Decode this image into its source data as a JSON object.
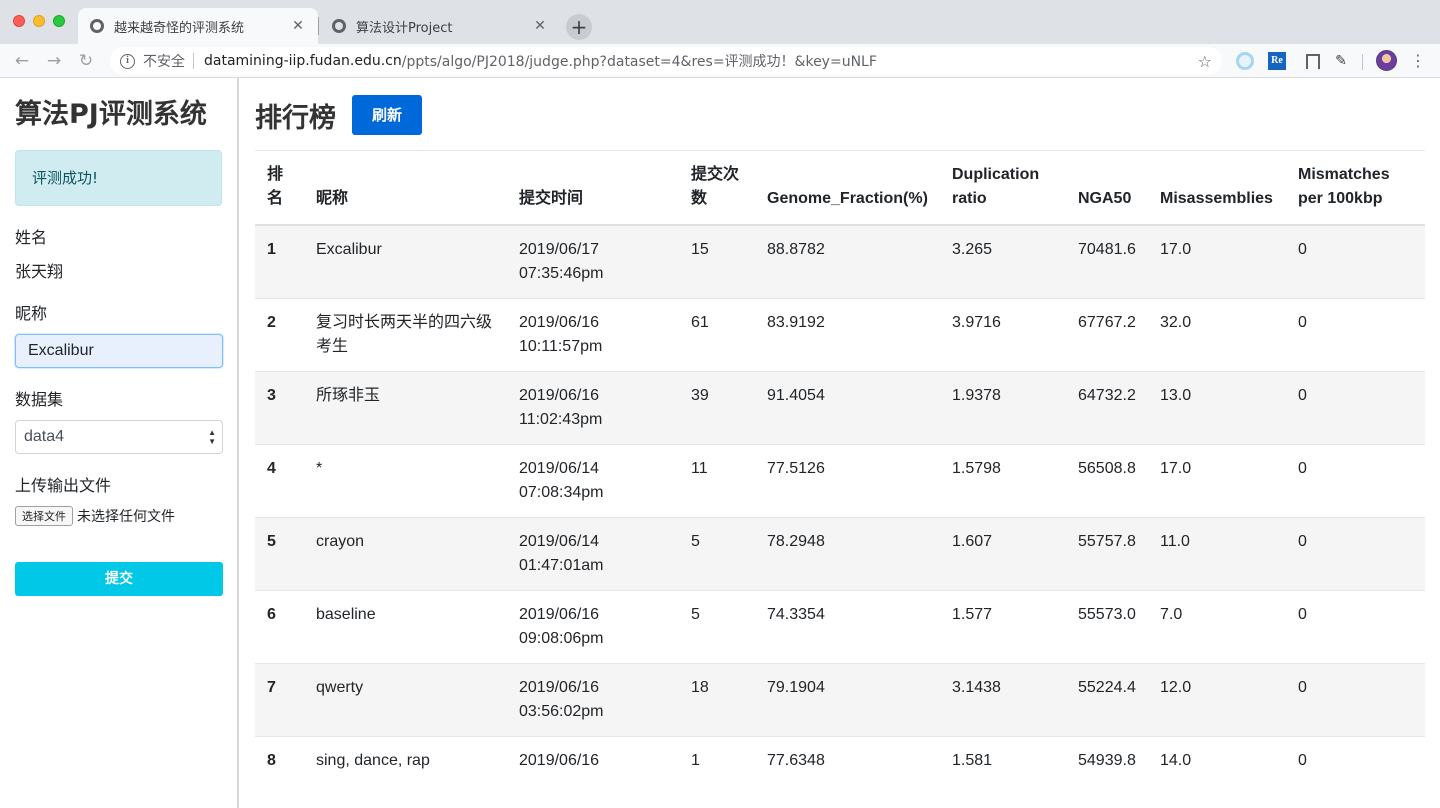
{
  "browser": {
    "tabs": [
      {
        "title": "越来越奇怪的评测系统",
        "active": true
      },
      {
        "title": "算法设计Project",
        "active": false
      }
    ],
    "security_label": "不安全",
    "url_host": "datamining-iip.fudan.edu.cn",
    "url_path": "/ppts/algo/PJ2018/judge.php?dataset=4&res=评测成功！&key=uNLF",
    "extension_re": "Re"
  },
  "sidebar": {
    "app_title": "算法PJ评测系统",
    "alert": "评测成功!",
    "name_label": "姓名",
    "name_value": "张天翔",
    "nickname_label": "昵称",
    "nickname_value": "Excalibur",
    "dataset_label": "数据集",
    "dataset_selected": "data4",
    "upload_label": "上传输出文件",
    "file_button": "选择文件",
    "file_status": "未选择任何文件",
    "submit_label": "提交"
  },
  "main": {
    "title": "排行榜",
    "refresh_label": "刷新",
    "columns": [
      "排名",
      "昵称",
      "提交时间",
      "提交次数",
      "Genome_Fraction(%)",
      "Duplication ratio",
      "NGA50",
      "Misassemblies",
      "Mismatches per 100kbp"
    ],
    "rows": [
      {
        "rank": "1",
        "nick": "Excalibur",
        "time": "2019/06/17 07:35:46pm",
        "count": "15",
        "genome": "88.8782",
        "dup": "3.265",
        "nga50": "70481.6",
        "misasm": "17.0",
        "mismatch": "0"
      },
      {
        "rank": "2",
        "nick": "复习时长两天半的四六级考生",
        "time": "2019/06/16 10:11:57pm",
        "count": "61",
        "genome": "83.9192",
        "dup": "3.9716",
        "nga50": "67767.2",
        "misasm": "32.0",
        "mismatch": "0"
      },
      {
        "rank": "3",
        "nick": "所琢非玉",
        "time": "2019/06/16 11:02:43pm",
        "count": "39",
        "genome": "91.4054",
        "dup": "1.9378",
        "nga50": "64732.2",
        "misasm": "13.0",
        "mismatch": "0"
      },
      {
        "rank": "4",
        "nick": "*",
        "time": "2019/06/14 07:08:34pm",
        "count": "11",
        "genome": "77.5126",
        "dup": "1.5798",
        "nga50": "56508.8",
        "misasm": "17.0",
        "mismatch": "0"
      },
      {
        "rank": "5",
        "nick": "crayon",
        "time": "2019/06/14 01:47:01am",
        "count": "5",
        "genome": "78.2948",
        "dup": "1.607",
        "nga50": "55757.8",
        "misasm": "11.0",
        "mismatch": "0"
      },
      {
        "rank": "6",
        "nick": "baseline",
        "time": "2019/06/16 09:08:06pm",
        "count": "5",
        "genome": "74.3354",
        "dup": "1.577",
        "nga50": "55573.0",
        "misasm": "7.0",
        "mismatch": "0"
      },
      {
        "rank": "7",
        "nick": "qwerty",
        "time": "2019/06/16 03:56:02pm",
        "count": "18",
        "genome": "79.1904",
        "dup": "3.1438",
        "nga50": "55224.4",
        "misasm": "12.0",
        "mismatch": "0"
      },
      {
        "rank": "8",
        "nick": "sing, dance, rap",
        "time": "2019/06/16",
        "count": "1",
        "genome": "77.6348",
        "dup": "1.581",
        "nga50": "54939.8",
        "misasm": "14.0",
        "mismatch": "0"
      }
    ]
  }
}
